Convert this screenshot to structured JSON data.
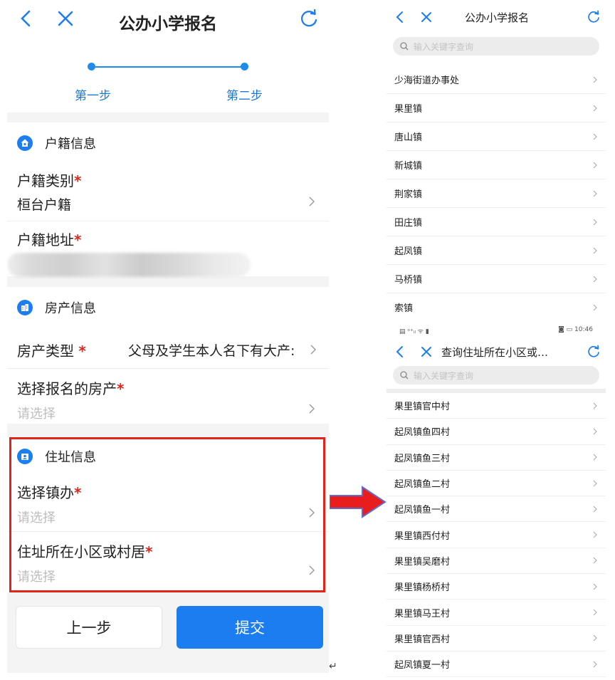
{
  "left": {
    "title": "公办小学报名",
    "steps": [
      "第一步",
      "第二步"
    ],
    "sections": {
      "huji": {
        "title": "户籍信息",
        "type_label": "户籍类别",
        "type_value": "桓台户籍",
        "address_label": "户籍地址"
      },
      "fangchan": {
        "title": "房产信息",
        "type_label": "房产类型 ",
        "type_value": "父母及学生本人名下有大产:",
        "select_label": "选择报名的房产",
        "select_placeholder": "请选择"
      },
      "zhuzhi": {
        "title": "住址信息",
        "town_label": "选择镇办",
        "town_placeholder": "请选择",
        "community_label": "住址所在小区或村居",
        "community_placeholder": "请选择"
      }
    },
    "required_mark": "*",
    "buttons": {
      "prev": "上一步",
      "submit": "提交"
    },
    "colors": {
      "accent": "#1c7df0",
      "highlight": "#e2231a"
    }
  },
  "right_top": {
    "title": "公办小学报名",
    "search_placeholder": "输入关键字查询",
    "items": [
      "少海街道办事处",
      "果里镇",
      "唐山镇",
      "新城镇",
      "荆家镇",
      "田庄镇",
      "起凤镇",
      "马桥镇",
      "索镇"
    ]
  },
  "right_bottom": {
    "status_left": "▤ ᵒ⁺ᵢₗ ᯤ ▮",
    "status_right": "◙ ▭ 10:46",
    "title": "查询住址所在小区或…",
    "search_placeholder": "输入关键字查询",
    "items": [
      "果里镇官中村",
      "起凤镇鱼四村",
      "起凤镇鱼三村",
      "起凤镇鱼二村",
      "起凤镇鱼一村",
      "果里镇西付村",
      "果里镇吴磨村",
      "果里镇杨桥村",
      "果里镇马王村",
      "果里镇官西村",
      "起凤镇夏一村"
    ]
  },
  "return_mark": "↵"
}
